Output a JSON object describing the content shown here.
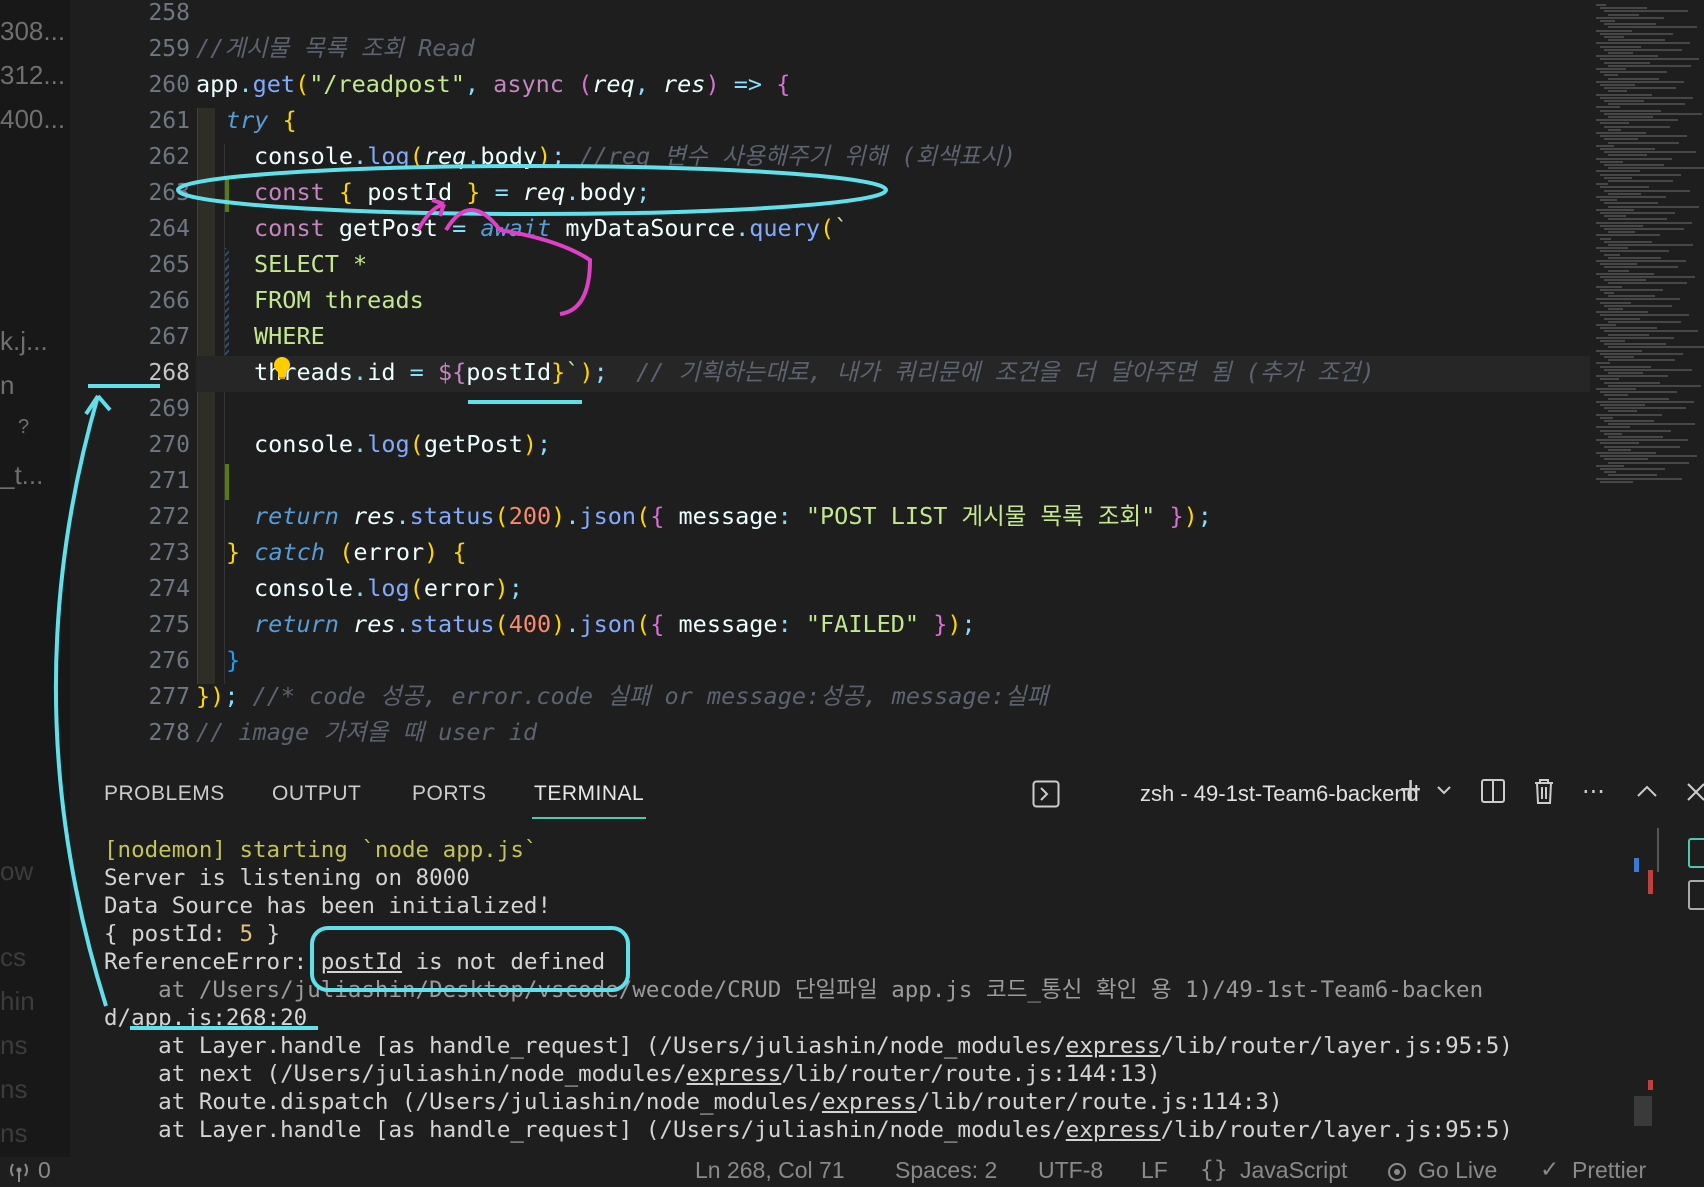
{
  "left_fragments": [
    "308...",
    "312...",
    "400...",
    "k.j...",
    "n",
    "?",
    "_t...",
    "ow",
    "cs",
    "hin",
    "ns",
    "ns",
    "ns"
  ],
  "editor": {
    "active_line": "268",
    "lines": [
      {
        "num": "258",
        "code": ""
      },
      {
        "num": "259",
        "code": "//게시물 목록 조회 Read"
      },
      {
        "num": "260",
        "code": "app.get(\"/readpost\", async (req, res) => {"
      },
      {
        "num": "261",
        "code": "try {"
      },
      {
        "num": "262",
        "code": "console.log(req.body); //req 변수 사용해주기 위해 (회색표시)"
      },
      {
        "num": "263",
        "code": "const { postId } = req.body;"
      },
      {
        "num": "264",
        "code": "const getPost = await myDataSource.query(`"
      },
      {
        "num": "265",
        "code": "SELECT *"
      },
      {
        "num": "266",
        "code": "FROM threads"
      },
      {
        "num": "267",
        "code": "WHERE"
      },
      {
        "num": "268",
        "code": "threads.id = ${postId}`);  // 기획하는대로, 내가 쿼리문에 조건을 더 달아주면 됨 (추가 조건)"
      },
      {
        "num": "269",
        "code": ""
      },
      {
        "num": "270",
        "code": "console.log(getPost);"
      },
      {
        "num": "271",
        "code": ""
      },
      {
        "num": "272",
        "code": "return res.status(200).json({ message: \"POST LIST 게시물 목록 조회\" });"
      },
      {
        "num": "273",
        "code": "} catch (error) {"
      },
      {
        "num": "274",
        "code": "console.log(error);"
      },
      {
        "num": "275",
        "code": "return res.status(400).json({ message: \"FAILED\" });"
      },
      {
        "num": "276",
        "code": "}"
      },
      {
        "num": "277",
        "code": "}); //* code 성공, error.code 실패 or message:성공, message:실패"
      },
      {
        "num": "278",
        "code": "// image 가져올 때 user id"
      }
    ]
  },
  "panel": {
    "tabs": [
      "PROBLEMS",
      "OUTPUT",
      "PORTS",
      "TERMINAL"
    ],
    "active_tab": "TERMINAL",
    "terminal_title": "zsh - 49-1st-Team6-backend"
  },
  "terminal": {
    "lines": [
      "[nodemon] starting `node app.js`",
      "Server is listening on 8000",
      "Data Source has been initialized!",
      "{ postId: 5 }",
      "ReferenceError: postId is not defined",
      "    at /Users/juliashin/Desktop/vscode/wecode/CRUD 단일파일 app.js 코드_통신 확인 용 1)/49-1st-Team6-backen",
      "d/app.js:268:20",
      "    at Layer.handle [as handle_request] (/Users/juliashin/node_modules/express/lib/router/layer.js:95:5)",
      "    at next (/Users/juliashin/node_modules/express/lib/router/route.js:144:13)",
      "    at Route.dispatch (/Users/juliashin/node_modules/express/lib/router/route.js:114:3)",
      "    at Layer.handle [as handle_request] (/Users/juliashin/node_modules/express/lib/router/layer.js:95:5)"
    ]
  },
  "statusbar": {
    "ports": "0",
    "cursor": "Ln 268, Col 71",
    "spaces": "Spaces: 2",
    "encoding": "UTF-8",
    "eol": "LF",
    "language": "JavaScript",
    "golive": "Go Live",
    "prettier": "Prettier"
  },
  "colors": {
    "annotation_cyan": "#5fe0ea",
    "annotation_magenta": "#e040c8",
    "accent_teal": "#4ec9b0"
  }
}
